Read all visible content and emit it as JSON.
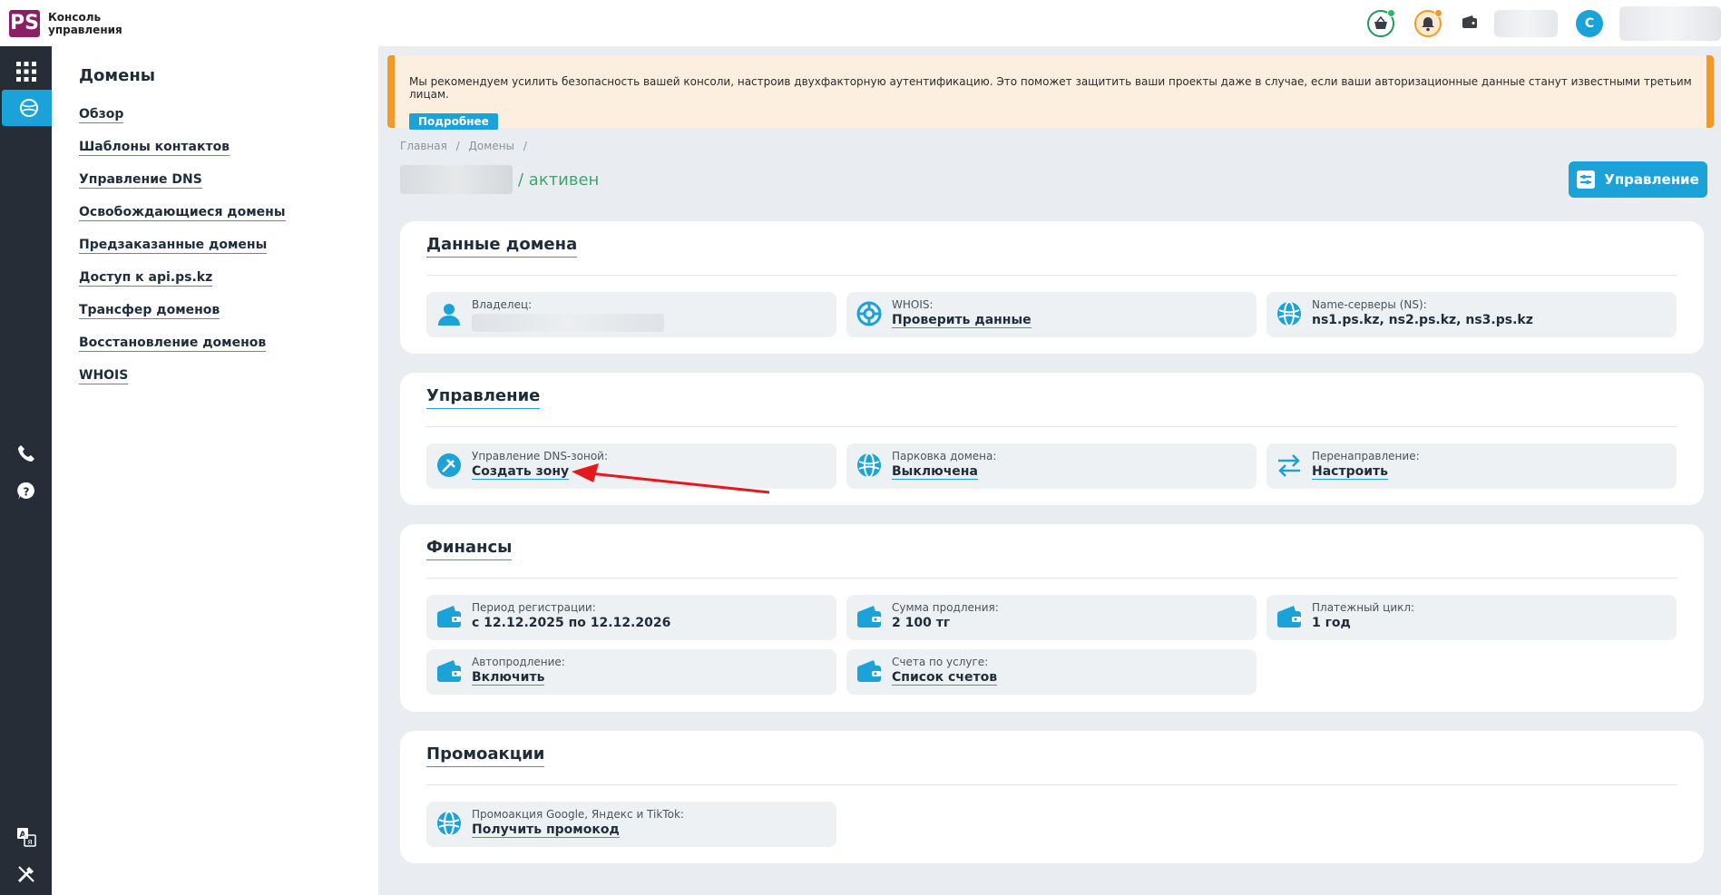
{
  "header": {
    "logo_mark": "PS",
    "logo_line1": "Консоль",
    "logo_line2": "управления",
    "avatar_letter": "С"
  },
  "sidebar": {
    "title": "Домены",
    "items": [
      {
        "label": "Обзор"
      },
      {
        "label": "Шаблоны контактов"
      },
      {
        "label": "Управление DNS"
      },
      {
        "label": "Освобождающиеся домены"
      },
      {
        "label": "Предзаказанные домены"
      },
      {
        "label": "Доступ к api.ps.kz"
      },
      {
        "label": "Трансфер доменов"
      },
      {
        "label": "Восстановление доменов"
      },
      {
        "label": "WHOIS"
      }
    ]
  },
  "alert": {
    "text": "Мы рекомендуем усилить безопасность вашей консоли, настроив двухфакторную аутентификацию. Это поможет защитить ваши проекты даже в случае, если ваши авторизационные данные станут известными третьим лицам.",
    "more_label": "Подробнее"
  },
  "breadcrumb": {
    "home": "Главная",
    "sep": "/",
    "domains": "Домены"
  },
  "page": {
    "status": "/ активен",
    "manage_button": "Управление"
  },
  "domain_data": {
    "title": "Данные домена",
    "owner_label": "Владелец:",
    "whois_label": "WHOIS:",
    "whois_value": "Проверить данные",
    "ns_label": "Name-серверы (NS):",
    "ns_value": "ns1.ps.kz, ns2.ps.kz, ns3.ps.kz"
  },
  "management": {
    "title": "Управление",
    "dns_label": "Управление DNS-зоной:",
    "dns_value": "Создать зону",
    "parking_label": "Парковка домена:",
    "parking_value": "Выключена",
    "redirect_label": "Перенаправление:",
    "redirect_value": "Настроить"
  },
  "finance": {
    "title": "Финансы",
    "period_label": "Период регистрации:",
    "period_value": "с 12.12.2025 по 12.12.2026",
    "renew_label": "Сумма продления:",
    "renew_value": "2 100 тг",
    "cycle_label": "Платежный цикл:",
    "cycle_value": "1 год",
    "auto_label": "Автопродление:",
    "auto_value": "Включить",
    "invoices_label": "Счета по услуге:",
    "invoices_value": "Список счетов"
  },
  "promo": {
    "title": "Промоакции",
    "label": "Промоакция Google, Яндекс и TikTok:",
    "value": "Получить промокод"
  },
  "colors": {
    "accent": "#1ba2d8",
    "rail": "#262d36",
    "warning": "#f29a25",
    "active_status": "#3aa86a",
    "arrow": "#e5191d"
  }
}
